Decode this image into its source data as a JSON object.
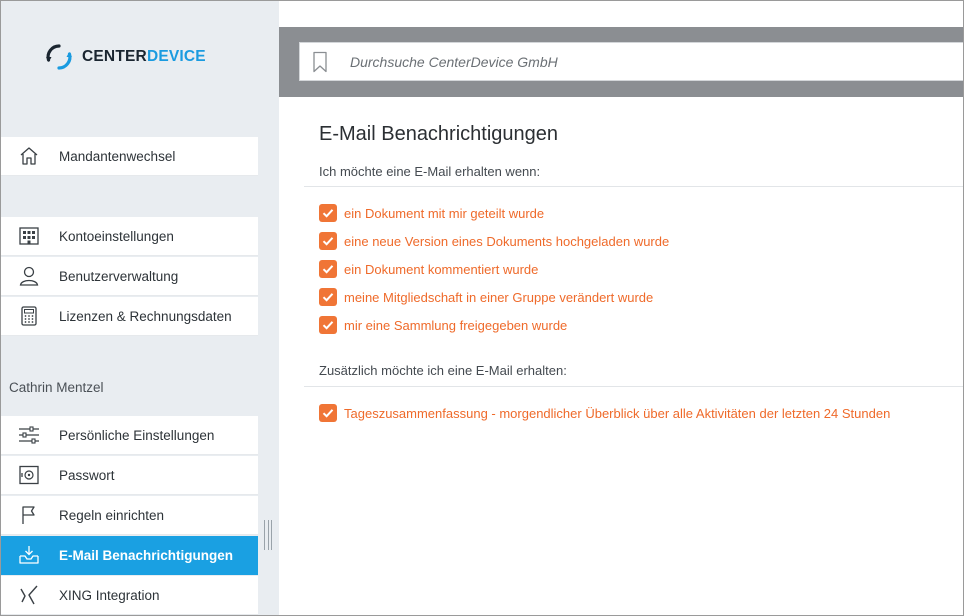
{
  "logo": {
    "part1": "CENTER",
    "part2": "DEVICE"
  },
  "search": {
    "placeholder": "Durchsuche CenterDevice GmbH"
  },
  "sidebar": {
    "tenant_item": {
      "label": "Mandantenwechsel",
      "icon": "home-icon"
    },
    "admin_items": [
      {
        "label": "Kontoeinstellungen",
        "icon": "building-icon"
      },
      {
        "label": "Benutzerverwaltung",
        "icon": "user-icon"
      },
      {
        "label": "Lizenzen & Rechnungsdaten",
        "icon": "calculator-icon"
      }
    ],
    "user_name": "Cathrin Mentzel",
    "user_items": [
      {
        "label": "Persönliche Einstellungen",
        "icon": "sliders-icon"
      },
      {
        "label": "Passwort",
        "icon": "safe-icon"
      },
      {
        "label": "Regeln einrichten",
        "icon": "flag-icon"
      },
      {
        "label": "E-Mail Benachrichtigungen",
        "icon": "inbox-download-icon",
        "active": true
      },
      {
        "label": "XING Integration",
        "icon": "xing-icon"
      }
    ]
  },
  "main": {
    "title": "E-Mail Benachrichtigungen",
    "section1_heading": "Ich möchte eine E-Mail erhalten wenn:",
    "section1_options": [
      {
        "label": "ein Dokument mit mir geteilt wurde",
        "checked": true
      },
      {
        "label": "eine neue Version eines Dokuments hochgeladen wurde",
        "checked": true
      },
      {
        "label": "ein Dokument kommentiert wurde",
        "checked": true
      },
      {
        "label": "meine Mitgliedschaft in einer Gruppe verändert wurde",
        "checked": true
      },
      {
        "label": "mir eine Sammlung freigegeben wurde",
        "checked": true
      }
    ],
    "section2_heading": "Zusätzlich möchte ich eine E-Mail erhalten:",
    "section2_options": [
      {
        "label": "Tageszusammenfassung - morgendlicher Überblick über alle Aktivitäten der letzten 24 Stunden",
        "checked": true
      }
    ]
  },
  "colors": {
    "accent_blue": "#1aa0e2",
    "checkbox_orange": "#f07536",
    "option_text_orange": "#ef6a2a",
    "sidebar_bg": "#e9edf1",
    "topbar_bg": "#8b8e92"
  }
}
